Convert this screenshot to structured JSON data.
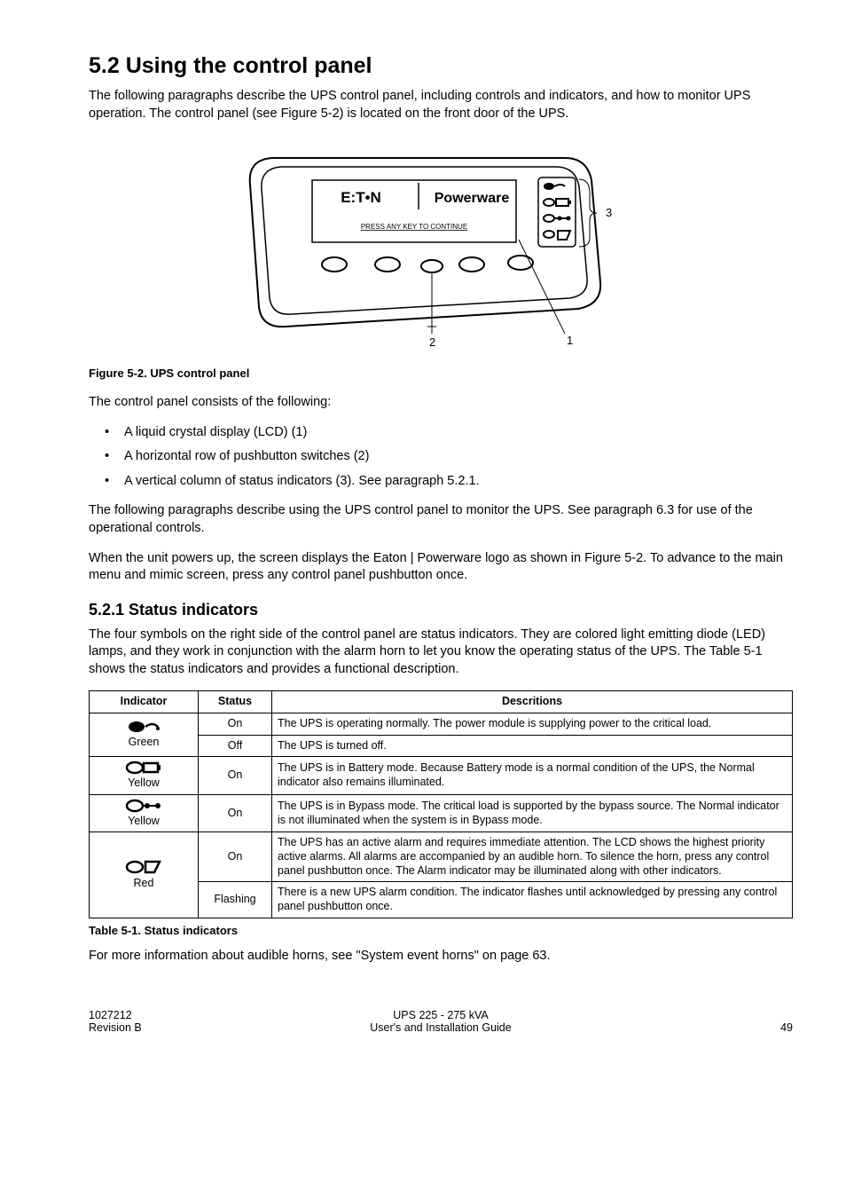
{
  "heading": "5.2 Using the control panel",
  "intro": "The following paragraphs describe the UPS control panel, including controls and indicators, and how to monitor UPS operation. The control panel (see Figure 5-2) is located on the front door of the UPS.",
  "figure": {
    "brand_left": "E:T•N",
    "brand_right": "Powerware",
    "screen_text": "PRESS ANY KEY TO CONTINUE",
    "callout_1": "1",
    "callout_2": "2",
    "callout_3": "3",
    "caption": "Figure 5-2. UPS control panel"
  },
  "after_figure": "The control panel consists of the following:",
  "bullets": [
    "A liquid crystal display (LCD) (1)",
    "A horizontal row of pushbutton switches (2)",
    "A vertical column of status indicators (3). See paragraph 5.2.1."
  ],
  "para_after_bullets_1": "The following paragraphs describe using the UPS control panel to monitor the UPS. See paragraph 6.3 for use of the operational controls.",
  "para_after_bullets_2": "When the unit powers up, the screen displays the Eaton | Powerware logo as shown in Figure 5-2. To advance to the main menu and mimic screen, press any control panel pushbutton once.",
  "subheading": "5.2.1 Status indicators",
  "sub_intro": "The four symbols on the right side of the control panel are status indicators. They are colored light emitting diode (LED) lamps, and they work in conjunction with the alarm horn to let you know the operating status of the UPS. The Table 5-1 shows the status indicators and provides a functional description.",
  "table": {
    "headers": {
      "c1": "Indicator",
      "c2": "Status",
      "c3": "Descritions"
    },
    "rows": [
      {
        "indicator_color": "Green",
        "icon": "normal",
        "status": "On",
        "desc": "The UPS is operating normally. The power module is supplying power to the critical load.",
        "status2": "Off",
        "desc2": "The UPS is turned off."
      },
      {
        "indicator_color": "Yellow",
        "icon": "battery",
        "status": "On",
        "desc": "The UPS is in Battery mode. Because Battery mode is a normal condition of the UPS, the Normal indicator also remains illuminated."
      },
      {
        "indicator_color": "Yellow",
        "icon": "bypass",
        "status": "On",
        "desc": "The UPS is in Bypass mode. The critical load is supported by the bypass source. The Normal indicator is not illuminated when the system is in Bypass mode."
      },
      {
        "indicator_color": "Red",
        "icon": "alarm",
        "status": "On",
        "desc": "The UPS has an active alarm and requires immediate attention. The LCD shows the highest priority active alarms. All alarms are accompanied by an audible horn. To silence the horn, press any control panel pushbutton once. The Alarm indicator may be illuminated along with other indicators.",
        "status2": "Flashing",
        "desc2": "There is a new UPS alarm condition. The indicator flashes until acknowledged by pressing any control panel pushbutton once."
      }
    ],
    "caption": "Table 5-1. Status indicators"
  },
  "after_table": "For more information about audible horns, see \"System event horns\" on page 63.",
  "footer": {
    "doc_no": "1027212",
    "revision": "Revision B",
    "title_line1": "UPS 225 - 275 kVA",
    "title_line2": "User's and Installation Guide",
    "page_no": "49"
  }
}
